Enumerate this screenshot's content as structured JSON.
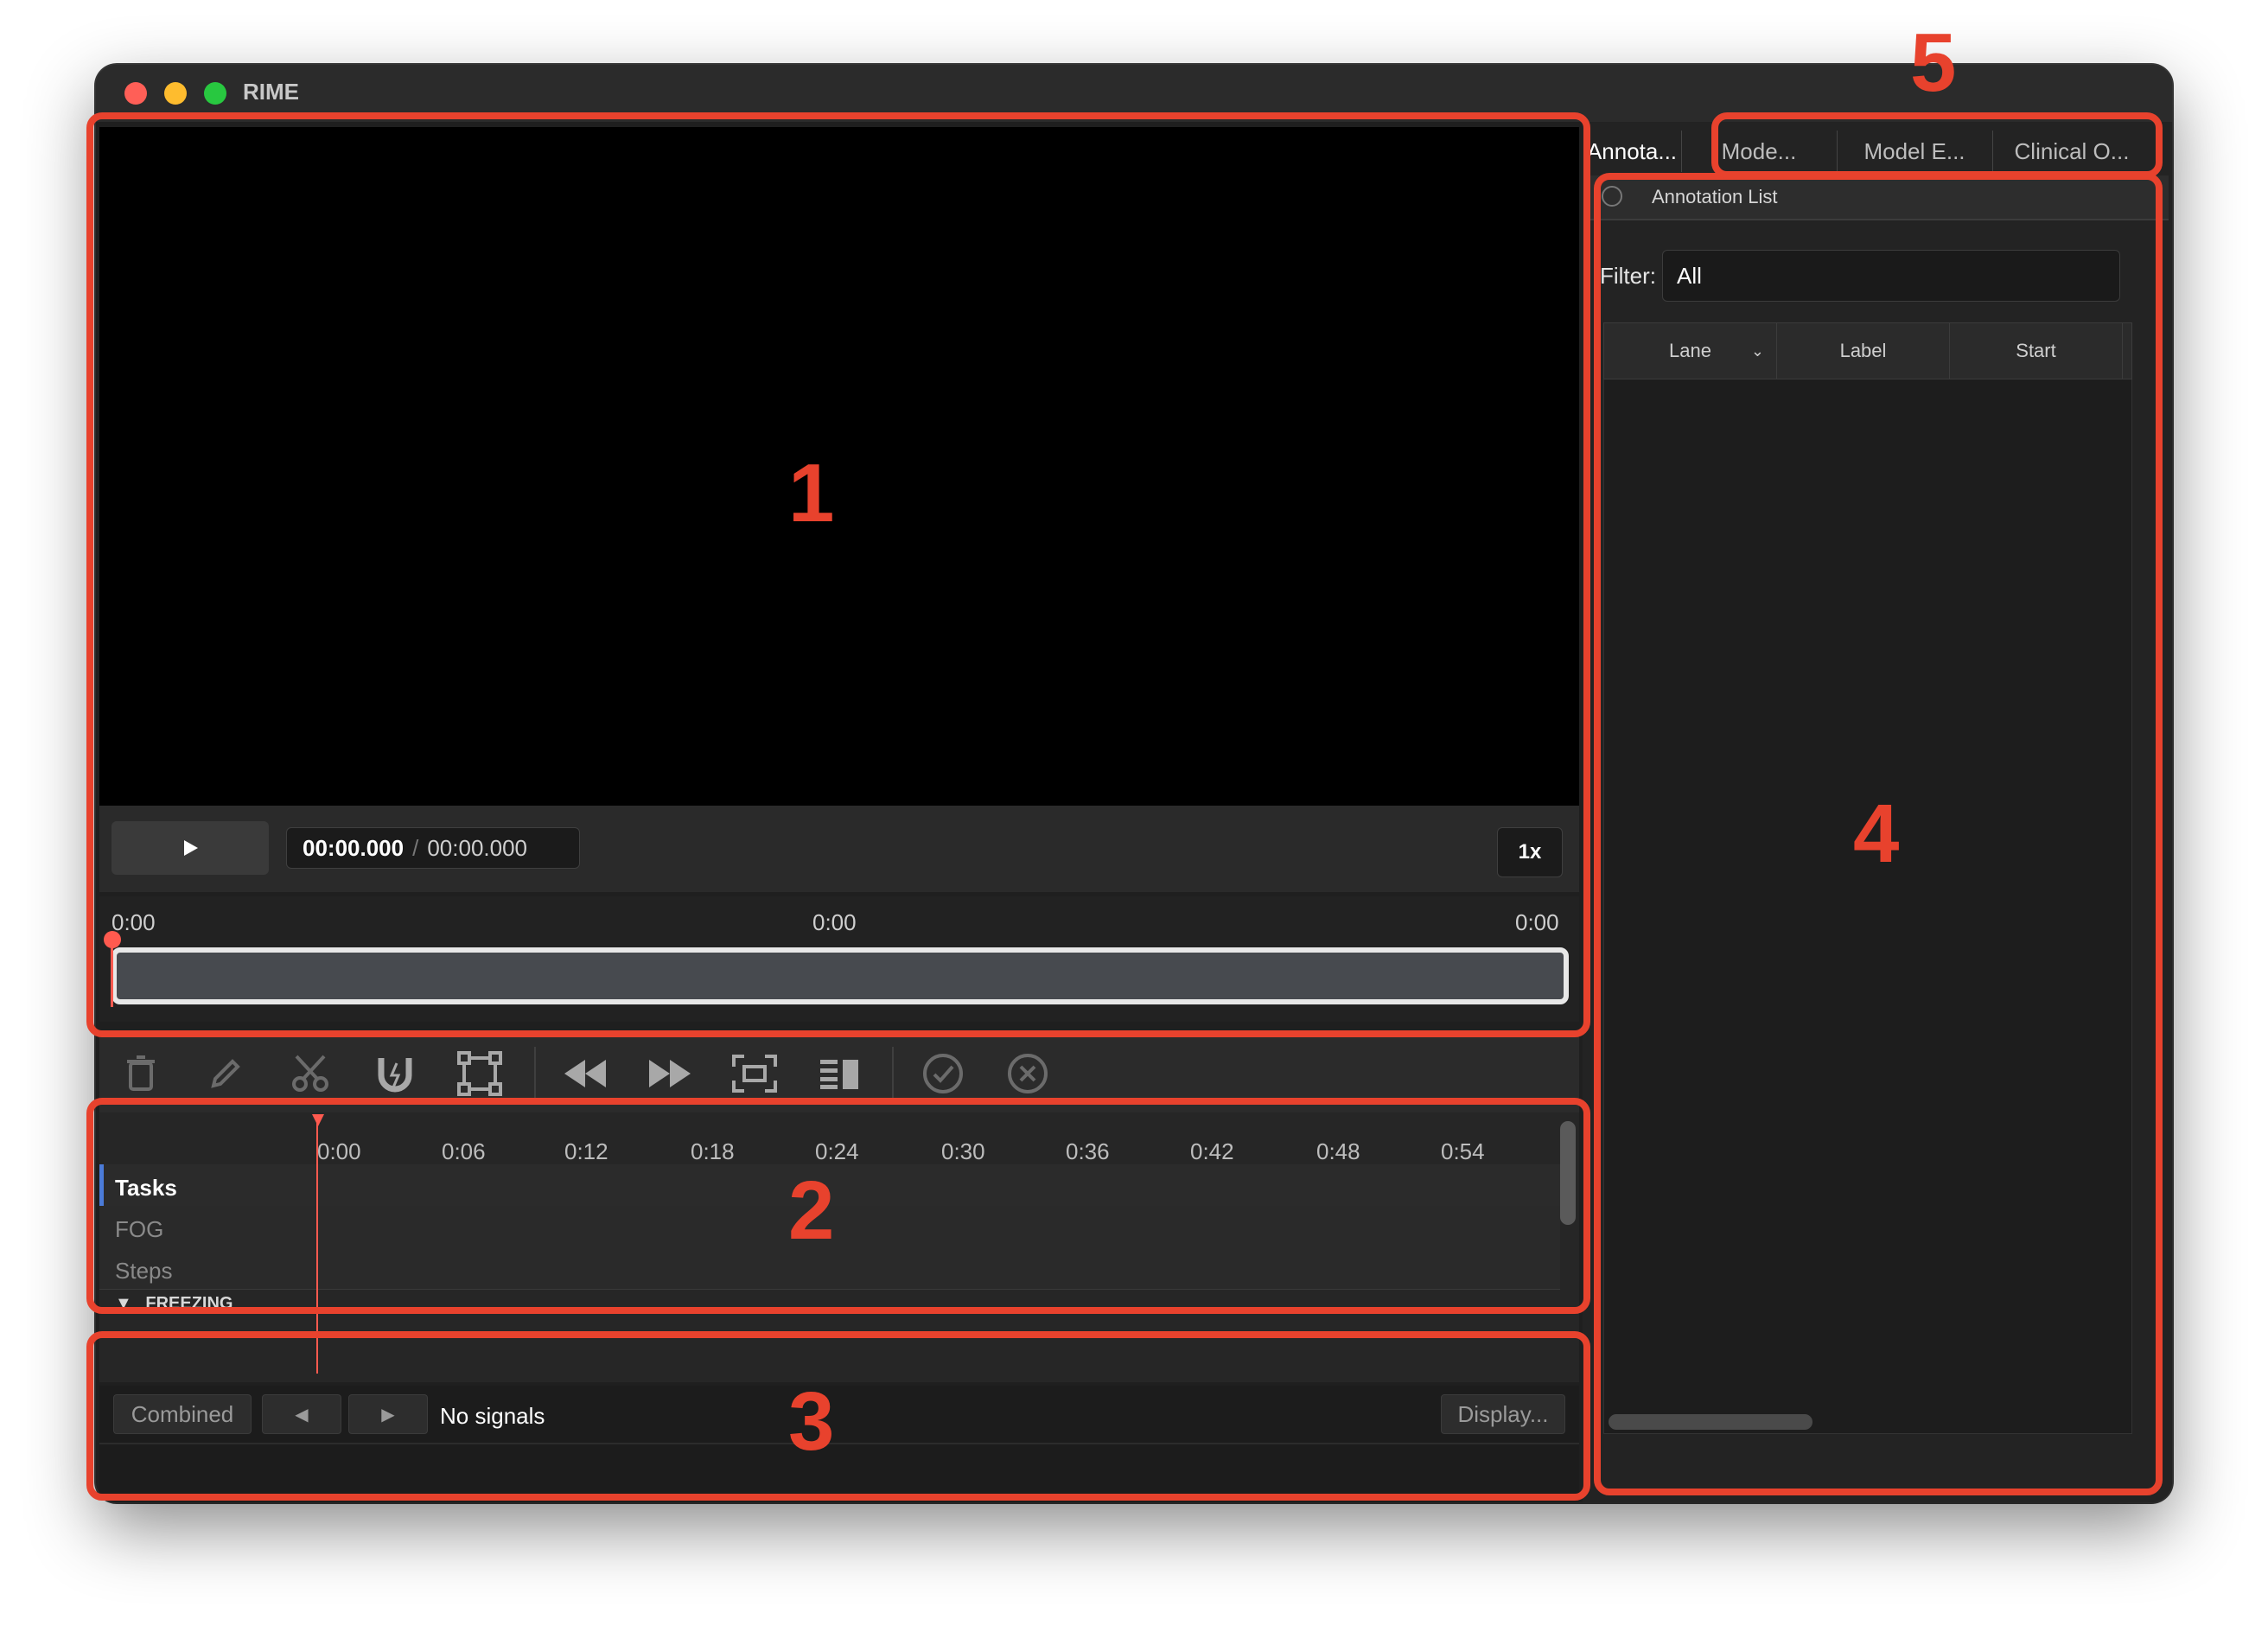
{
  "window": {
    "title": "RIME"
  },
  "player": {
    "play_icon": "play-icon",
    "current_time": "00:00.000",
    "separator": "/",
    "total_time": "00:00.000",
    "speed": "1x"
  },
  "scrubber": {
    "start": "0:00",
    "mid": "0:00",
    "end": "0:00"
  },
  "toolbar": {
    "icons": [
      "trash-icon",
      "pencil-icon",
      "scissors-icon",
      "magnet-icon",
      "bounding-box-icon",
      "rewind-icon",
      "fast-forward-icon",
      "fit-screen-icon",
      "columns-icon",
      "checkmark-icon",
      "cancel-icon"
    ]
  },
  "timeline": {
    "ruler": [
      "0:00",
      "0:06",
      "0:12",
      "0:18",
      "0:24",
      "0:30",
      "0:36",
      "0:42",
      "0:48",
      "0:54"
    ],
    "lanes": [
      "Tasks",
      "FOG",
      "Steps"
    ],
    "group": "FREEZING"
  },
  "signals": {
    "mode": "Combined",
    "prev": "◀",
    "next": "▶",
    "status": "No signals",
    "display": "Display..."
  },
  "right_panel": {
    "tabs": [
      "Annota...",
      "Mode...",
      "Model E...",
      "Clinical O..."
    ],
    "header": "Annotation List",
    "filter_label": "Filter:",
    "filter_value": "All",
    "columns": [
      "Lane",
      "Label",
      "Start"
    ]
  },
  "annotations": {
    "labels": [
      "1",
      "2",
      "3",
      "4",
      "5"
    ]
  },
  "colors": {
    "accent": "#e8422d",
    "playhead": "#ff5a4f"
  }
}
